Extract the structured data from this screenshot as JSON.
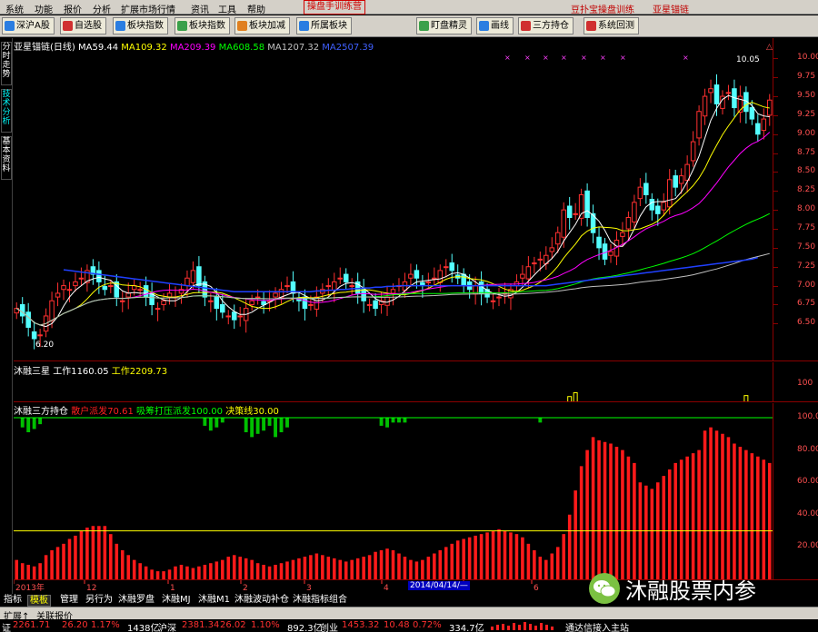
{
  "menubar": {
    "items": [
      "系统",
      "功能",
      "报价",
      "分析",
      "扩展市场行情",
      "资讯",
      "工具",
      "帮助"
    ],
    "special": "操盘手训练营",
    "right_items": [
      "豆扑宝操盘训练",
      "亚星锚链"
    ]
  },
  "toolbar": {
    "buttons": [
      {
        "label": "深沪A股",
        "icon_color": "#2a7de1",
        "icon": "grid-icon"
      },
      {
        "label": "自选股",
        "icon_color": "#d03030",
        "icon": "star-icon"
      },
      {
        "label": "板块指数",
        "icon_color": "#2a7de1",
        "icon": "block-icon"
      },
      {
        "label": "板块指数",
        "icon_color": "#3aa04a",
        "icon": "chart-icon"
      },
      {
        "label": "板块加减",
        "icon_color": "#e08020",
        "icon": "plusminus-icon"
      },
      {
        "label": "所属板块",
        "icon_color": "#2a7de1",
        "icon": "folder-icon"
      },
      {
        "label": "盯盘精灵",
        "icon_color": "#3aa04a",
        "icon": "check-icon"
      },
      {
        "label": "画线",
        "icon_color": "#2a7de1",
        "icon": "pen-icon"
      },
      {
        "label": "三方持仓",
        "icon_color": "#d03030",
        "icon": "list-icon"
      },
      {
        "label": "系统回测",
        "icon_color": "#d03030",
        "icon": "test-icon"
      }
    ]
  },
  "sidebar": {
    "tabs": [
      "分时走势",
      "技术分析",
      "基本资料"
    ]
  },
  "price_panel": {
    "stock_name": "亚星锚链(日线)",
    "ma": [
      {
        "label": "MA5",
        "value": "9.44",
        "color": "#ffffff"
      },
      {
        "label": "MA10",
        "value": "9.32",
        "color": "#ffff00"
      },
      {
        "label": "MA20",
        "value": "9.39",
        "color": "#ff00ff"
      },
      {
        "label": "MA60",
        "value": "8.58",
        "color": "#00ff00"
      },
      {
        "label": "MA120",
        "value": "7.32",
        "color": "#c0c0c0"
      },
      {
        "label": "MA250",
        "value": "7.39",
        "color": "#0000ff"
      }
    ],
    "low_label": "6.20",
    "high_label": "10.05",
    "corner_text": "△闪"
  },
  "volume_panel": {
    "title": "沐融三星",
    "lines": [
      {
        "label": "工作1",
        "value": "160.05"
      },
      {
        "label": "工作2",
        "value": "209.73"
      }
    ],
    "axis_label": "100"
  },
  "osc_panel": {
    "title": "沐融三方持仓",
    "items": [
      {
        "label": "散户派发",
        "value": "70.61",
        "color": "#ff2020"
      },
      {
        "label": "吸筹打压派发",
        "value": "100.00",
        "color": "#00ff00"
      },
      {
        "label": "决策线",
        "value": "30.00",
        "color": "#ffff00"
      }
    ]
  },
  "x_axis": {
    "labels": [
      "2013年",
      "12",
      "1",
      "2",
      "3",
      "4",
      "5",
      "6"
    ],
    "cursor_date": "2014/04/14/—"
  },
  "tabs": [
    "指标",
    "模板",
    "管理",
    "另行为",
    "沐融罗盘",
    "沐融MJ",
    "沐融M1",
    "沐融波动补仓",
    "沐融指标组合"
  ],
  "expand_bar": {
    "label": "扩展↑",
    "text": "关联报价"
  },
  "statusbar": {
    "items": [
      {
        "label": "证",
        "value": "2261.71",
        "change": "26.20",
        "pct": "1.17%",
        "amount": "1438亿"
      },
      {
        "label": "沪深",
        "value": "2381.34",
        "change": "26.02",
        "pct": "1.10%",
        "amount": "892.3亿"
      },
      {
        "label": "创业",
        "value": "1453.32",
        "change": "10.48",
        "pct": "0.72%",
        "amount": "334.7亿"
      }
    ],
    "conn_text": "通达信接入主站"
  },
  "watermark": {
    "text": "沐融股票内参"
  },
  "chart_data": [
    {
      "type": "candlestick",
      "title": "亚星锚链(日线)",
      "y_ticks": [
        "10.00",
        "9.75",
        "9.50",
        "9.25",
        "9.00",
        "8.75",
        "8.50",
        "8.25",
        "8.00",
        "7.75",
        "7.50",
        "7.25",
        "7.00",
        "6.75",
        "6.50"
      ],
      "ylim": [
        6.0,
        10.1
      ],
      "x": [
        "2013-11",
        "12",
        "1",
        "2",
        "3",
        "4",
        "5",
        "6"
      ],
      "series": [
        {
          "name": "MA5",
          "color": "#ffffff"
        },
        {
          "name": "MA10",
          "color": "#ffff00"
        },
        {
          "name": "MA20",
          "color": "#ff00ff"
        },
        {
          "name": "MA60",
          "color": "#00ff00"
        },
        {
          "name": "MA120",
          "color": "#c0c0c0"
        },
        {
          "name": "MA250",
          "color": "#2040ff"
        }
      ],
      "close": [
        6.7,
        6.6,
        6.45,
        6.3,
        6.35,
        6.6,
        6.8,
        6.9,
        7.0,
        6.95,
        7.05,
        7.1,
        7.2,
        7.15,
        7.05,
        6.95,
        7.0,
        6.85,
        6.8,
        6.9,
        7.0,
        6.95,
        6.85,
        6.75,
        6.7,
        6.8,
        6.9,
        6.85,
        6.95,
        7.1,
        7.2,
        7.0,
        6.85,
        6.8,
        6.7,
        6.65,
        6.6,
        6.55,
        6.6,
        6.7,
        6.8,
        6.85,
        6.75,
        6.8,
        6.9,
        6.95,
        7.0,
        6.9,
        6.8,
        6.7,
        6.75,
        6.85,
        6.95,
        7.0,
        7.05,
        7.1,
        7.05,
        7.0,
        6.9,
        6.8,
        6.75,
        6.7,
        6.8,
        6.85,
        6.95,
        7.0,
        7.05,
        7.15,
        7.1,
        7.0,
        7.05,
        7.1,
        7.2,
        7.25,
        7.2,
        7.1,
        7.0,
        6.95,
        7.0,
        6.9,
        6.85,
        6.8,
        6.85,
        6.9,
        6.95,
        7.05,
        7.15,
        7.25,
        7.3,
        7.35,
        7.4,
        7.5,
        7.7,
        8.0,
        7.9,
        7.95,
        8.2,
        7.9,
        7.7,
        7.5,
        7.35,
        7.45,
        7.6,
        7.7,
        7.9,
        8.1,
        8.3,
        8.2,
        8.0,
        7.95,
        8.1,
        8.4,
        8.3,
        8.45,
        8.6,
        8.9,
        9.3,
        9.5,
        9.6,
        9.4,
        9.5,
        9.55,
        9.35,
        9.5,
        9.3,
        9.2,
        9.0,
        9.2,
        9.45
      ],
      "ma250": [
        7.28,
        7.28,
        7.27,
        7.26,
        7.25,
        7.24,
        7.23,
        7.22,
        7.21,
        7.2,
        7.19,
        7.18,
        7.17,
        7.16,
        7.15,
        7.14,
        7.13,
        7.12,
        7.11,
        7.1,
        7.09,
        7.08,
        7.07,
        7.06,
        7.05,
        7.04,
        7.03,
        7.02,
        7.01,
        7.0,
        6.99,
        6.98,
        6.97,
        6.96,
        6.95,
        6.94,
        6.93,
        6.92,
        6.92,
        6.92,
        6.92,
        6.92,
        6.92,
        6.92,
        6.92,
        6.92,
        6.92,
        6.92,
        6.92,
        6.92,
        6.92,
        6.93,
        6.93,
        6.94,
        6.94,
        6.95,
        6.95,
        6.96,
        6.96,
        6.97,
        6.97,
        6.98,
        6.98,
        6.99,
        6.99,
        7.0,
        7.0,
        7.0,
        7.0,
        7.0,
        7.0,
        7.0,
        7.0,
        7.0,
        7.0,
        7.0,
        7.0,
        7.0,
        7.0,
        7.0,
        7.0,
        7.0,
        7.0,
        7.0,
        7.0,
        7.0,
        7.0,
        7.0,
        7.0,
        7.0,
        7.0,
        7.01,
        7.02,
        7.03,
        7.04,
        7.05,
        7.06,
        7.07,
        7.08,
        7.09,
        7.1,
        7.11,
        7.12,
        7.13,
        7.14,
        7.15,
        7.16,
        7.17,
        7.18,
        7.19,
        7.2,
        7.21,
        7.22,
        7.23,
        7.24,
        7.25,
        7.26,
        7.27,
        7.28,
        7.29,
        7.3,
        7.31,
        7.32,
        7.33,
        7.34,
        7.35,
        7.37
      ]
    },
    {
      "type": "bar",
      "title": "沐融三星",
      "ylim": [
        0,
        200
      ],
      "bars": [
        {
          "index": 94,
          "value": 30
        },
        {
          "index": 95,
          "value": 50
        },
        {
          "index": 124,
          "value": 35
        }
      ]
    },
    {
      "type": "bar",
      "title": "沐融三方持仓",
      "ylim": [
        0,
        100
      ],
      "y_ticks": [
        "100.00",
        "80.00",
        "60.00",
        "40.00",
        "20.00"
      ],
      "threshold": 30,
      "red": [
        12,
        10,
        9,
        8,
        10,
        15,
        18,
        20,
        22,
        25,
        27,
        30,
        32,
        33,
        33,
        33,
        28,
        22,
        18,
        15,
        12,
        10,
        8,
        6,
        5,
        5,
        6,
        8,
        9,
        8,
        7,
        8,
        9,
        10,
        11,
        12,
        14,
        15,
        14,
        13,
        12,
        10,
        9,
        8,
        9,
        10,
        11,
        12,
        13,
        14,
        15,
        16,
        15,
        14,
        13,
        12,
        11,
        12,
        13,
        14,
        15,
        17,
        18,
        19,
        18,
        16,
        14,
        12,
        11,
        12,
        14,
        16,
        18,
        20,
        22,
        24,
        25,
        26,
        27,
        28,
        29,
        30,
        31,
        30,
        29,
        28,
        26,
        22,
        18,
        14,
        12,
        16,
        20,
        28,
        40,
        55,
        70,
        80,
        88,
        86,
        85,
        84,
        82,
        80,
        76,
        72,
        60,
        58,
        56,
        60,
        64,
        68,
        72,
        74,
        76,
        78,
        80,
        92,
        94,
        92,
        90,
        88,
        84,
        82,
        80,
        78,
        76,
        74,
        72,
        70,
        68,
        66
      ],
      "green": [
        0,
        -6,
        -9,
        -7,
        -4,
        0,
        0,
        0,
        0,
        0,
        0,
        0,
        0,
        0,
        0,
        0,
        0,
        0,
        0,
        0,
        0,
        0,
        0,
        0,
        0,
        0,
        0,
        0,
        0,
        0,
        0,
        0,
        -5,
        -8,
        -6,
        -3,
        0,
        0,
        0,
        -9,
        -12,
        -10,
        -8,
        -5,
        -12,
        -9,
        -6,
        0,
        0,
        0,
        0,
        0,
        0,
        0,
        0,
        0,
        0,
        0,
        0,
        0,
        0,
        0,
        -5,
        -6,
        -3,
        -3,
        -3,
        0,
        0,
        0,
        0,
        0,
        0,
        0,
        0,
        0,
        0,
        0,
        0,
        0,
        0,
        0,
        0,
        0,
        0,
        0,
        0,
        0,
        0,
        -3,
        0,
        0,
        0,
        0,
        0,
        0,
        0,
        0,
        0,
        0,
        0,
        0,
        0,
        0,
        0,
        0,
        0,
        0,
        0,
        0,
        0,
        0,
        0,
        0,
        0,
        0,
        0,
        0,
        0,
        0,
        0,
        0,
        0,
        0,
        0,
        0,
        0,
        0,
        0,
        0,
        0,
        0,
        0,
        0,
        0
      ]
    }
  ]
}
